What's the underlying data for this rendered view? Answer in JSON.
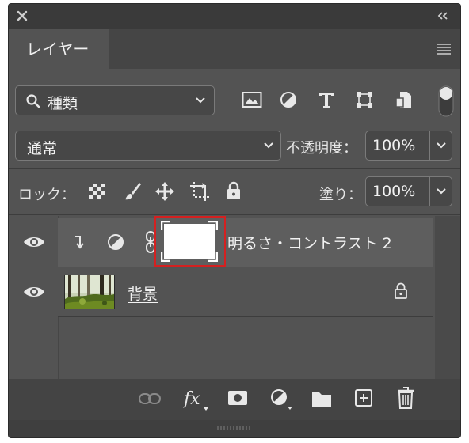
{
  "panel": {
    "tab_label": "レイヤー",
    "filter": {
      "label": "種類"
    },
    "blend_mode": "通常",
    "opacity": {
      "label": "不透明度：",
      "value": "100%"
    },
    "lock": {
      "label": "ロック："
    },
    "fill": {
      "label": "塗り：",
      "value": "100%"
    }
  },
  "layers": [
    {
      "name": "明るさ・コントラスト 2",
      "visible": true,
      "selected": true,
      "highlight_color": "#d42020"
    },
    {
      "name": "背景",
      "visible": true,
      "locked": true
    }
  ],
  "colors": {
    "panel_bg": "#535353",
    "selected_row": "#5e5e5e",
    "mask_highlight": "#d42020"
  }
}
